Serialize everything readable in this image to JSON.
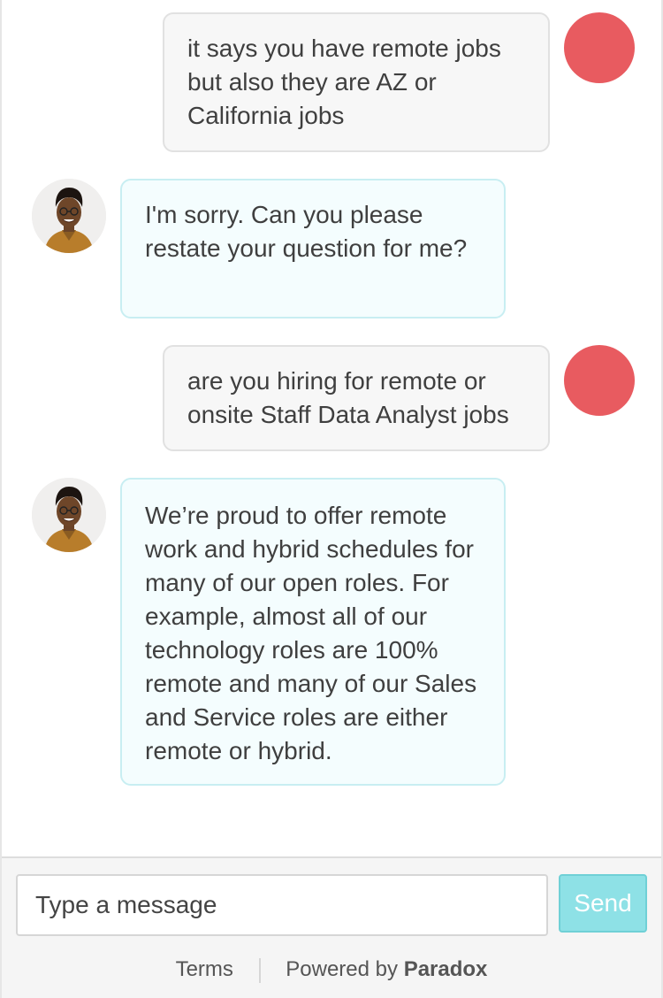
{
  "messages": [
    {
      "sender": "user",
      "text": "it says you have remote jobs but also they are AZ or California jobs"
    },
    {
      "sender": "bot",
      "text": "I'm sorry. Can you please restate your question for me?"
    },
    {
      "sender": "user",
      "text": "are you hiring for remote or onsite Staff Data Analyst jobs"
    },
    {
      "sender": "bot",
      "text": "We’re proud to offer remote work and hybrid schedules for many of our open roles. For example, almost all of our technology roles are 100% remote and many of our Sales and Service roles are either remote or hybrid."
    }
  ],
  "composer": {
    "placeholder": "Type a message",
    "value": "",
    "send_label": "Send"
  },
  "footer": {
    "terms_label": "Terms",
    "powered_by_label": "Powered by",
    "brand_name": "Paradox"
  },
  "colors": {
    "user_avatar": "#e85b60",
    "send_button": "#8ee1e6",
    "bot_bubble_bg": "#f4fdfe",
    "user_bubble_bg": "#f7f7f7"
  },
  "icons": {
    "user_avatar": "user-avatar-circle",
    "bot_avatar": "recruiter-avatar-photo"
  }
}
